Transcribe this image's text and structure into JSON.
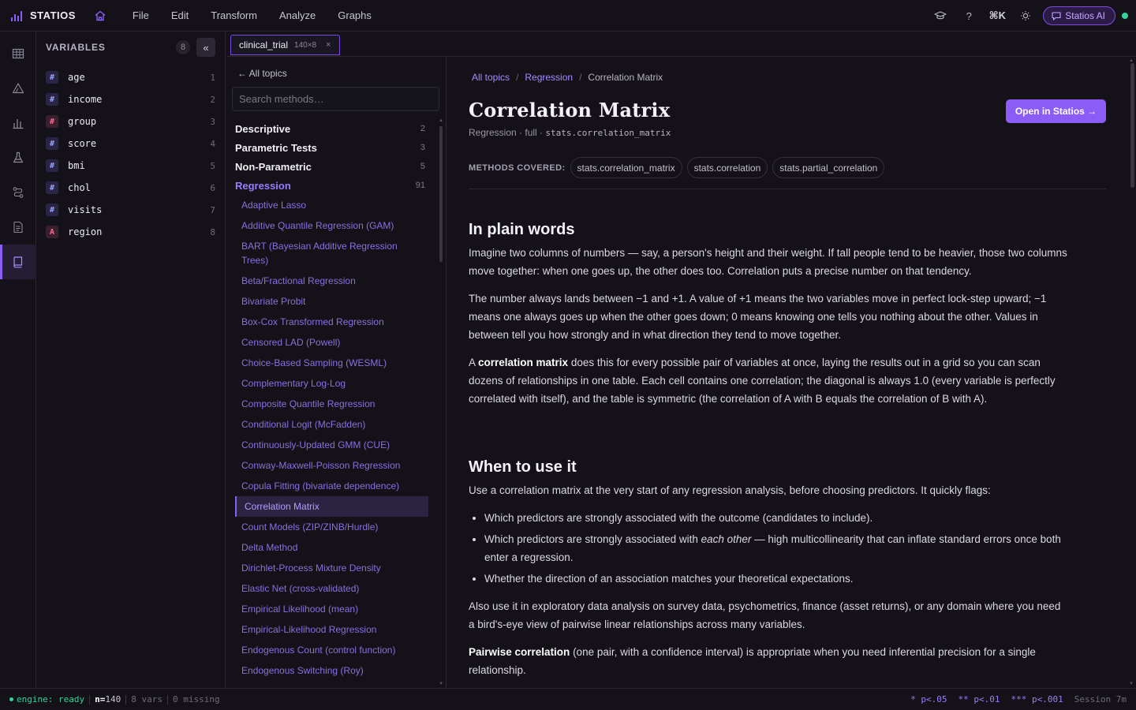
{
  "app": {
    "brand": "STATIOS"
  },
  "menu": [
    "File",
    "Edit",
    "Transform",
    "Analyze",
    "Graphs"
  ],
  "topbar": {
    "shortcut": "⌘K",
    "help": "?",
    "ai_label": "Statios AI"
  },
  "variables": {
    "title": "VARIABLES",
    "count": "8",
    "collapse": "«",
    "items": [
      {
        "type": "#",
        "kind": "num",
        "name": "age",
        "index": "1"
      },
      {
        "type": "#",
        "kind": "num",
        "name": "income",
        "index": "2"
      },
      {
        "type": "#",
        "kind": "cat",
        "name": "group",
        "index": "3"
      },
      {
        "type": "#",
        "kind": "num",
        "name": "score",
        "index": "4"
      },
      {
        "type": "#",
        "kind": "num",
        "name": "bmi",
        "index": "5"
      },
      {
        "type": "#",
        "kind": "num",
        "name": "chol",
        "index": "6"
      },
      {
        "type": "#",
        "kind": "num",
        "name": "visits",
        "index": "7"
      },
      {
        "type": "A",
        "kind": "str",
        "name": "region",
        "index": "8"
      }
    ]
  },
  "tab": {
    "name": "clinical_trial",
    "dims": "140×8",
    "close": "×"
  },
  "methods": {
    "back": "← All topics",
    "search_placeholder": "Search methods…",
    "categories": [
      {
        "name": "Descriptive",
        "count": "2"
      },
      {
        "name": "Parametric Tests",
        "count": "3"
      },
      {
        "name": "Non-Parametric",
        "count": "5"
      },
      {
        "name": "Regression",
        "count": "91"
      }
    ],
    "items": [
      "Adaptive Lasso",
      "Additive Quantile Regression (GAM)",
      "BART (Bayesian Additive Regression Trees)",
      "Beta/Fractional Regression",
      "Bivariate Probit",
      "Box-Cox Transformed Regression",
      "Censored LAD (Powell)",
      "Choice-Based Sampling (WESML)",
      "Complementary Log-Log",
      "Composite Quantile Regression",
      "Conditional Logit (McFadden)",
      "Continuously-Updated GMM (CUE)",
      "Conway-Maxwell-Poisson Regression",
      "Copula Fitting (bivariate dependence)",
      "Correlation Matrix",
      "Count Models (ZIP/ZINB/Hurdle)",
      "Delta Method",
      "Dirichlet-Process Mixture Density",
      "Elastic Net (cross-validated)",
      "Empirical Likelihood (mean)",
      "Empirical-Likelihood Regression",
      "Endogenous Count (control function)",
      "Endogenous Switching (Roy)"
    ],
    "active_index": 14
  },
  "doc": {
    "breadcrumb": {
      "root": "All topics",
      "section": "Regression",
      "current": "Correlation Matrix",
      "sep": "/"
    },
    "title": "Correlation Matrix",
    "sub_prefix": "Regression · full ·",
    "sub_code": "stats.correlation_matrix",
    "open_button": "Open in Statios →",
    "covered_label": "METHODS COVERED:",
    "covered": [
      "stats.correlation_matrix",
      "stats.correlation",
      "stats.partial_correlation"
    ],
    "plain": {
      "heading": "In plain words",
      "p1": "Imagine two columns of numbers — say, a person's height and their weight. If tall people tend to be heavier, those two columns move together: when one goes up, the other does too. Correlation puts a precise number on that tendency.",
      "p2": "The number always lands between −1 and +1. A value of +1 means the two variables move in perfect lock-step upward; −1 means one always goes up when the other goes down; 0 means knowing one tells you nothing about the other. Values in between tell you how strongly and in what direction they tend to move together.",
      "p3_a": "A ",
      "p3_b": "correlation matrix",
      "p3_c": " does this for every possible pair of variables at once, laying the results out in a grid so you can scan dozens of relationships in one table. Each cell contains one correlation; the diagonal is always 1.0 (every variable is perfectly correlated with itself), and the table is symmetric (the correlation of A with B equals the correlation of B with A)."
    },
    "when": {
      "heading": "When to use it",
      "intro": "Use a correlation matrix at the very start of any regression analysis, before choosing predictors. It quickly flags:",
      "b1": "Which predictors are strongly associated with the outcome (candidates to include).",
      "b2_a": "Which predictors are strongly associated with ",
      "b2_em": "each other",
      "b2_b": " — high multicollinearity that can inflate standard errors once both enter a regression.",
      "b3": "Whether the direction of an association matches your theoretical expectations.",
      "p_also": "Also use it in exploratory data analysis on survey data, psychometrics, finance (asset returns), or any domain where you need a bird's-eye view of pairwise linear relationships across many variables.",
      "p_pair_b": "Pairwise correlation",
      "p_pair": " (one pair, with a confidence interval) is appropriate when you need inferential precision for a single relationship."
    }
  },
  "status": {
    "engine": "engine: ready",
    "n_label": "n=",
    "n_value": "140",
    "vars": "8 vars",
    "missing": "0 missing",
    "sig1": "* p<.05",
    "sig2": "** p<.01",
    "sig3": "*** p<.001",
    "session": "Session 7m"
  },
  "colors": {
    "accent": "#8b5cf6",
    "ok": "#34d399",
    "link": "#a48bff"
  }
}
